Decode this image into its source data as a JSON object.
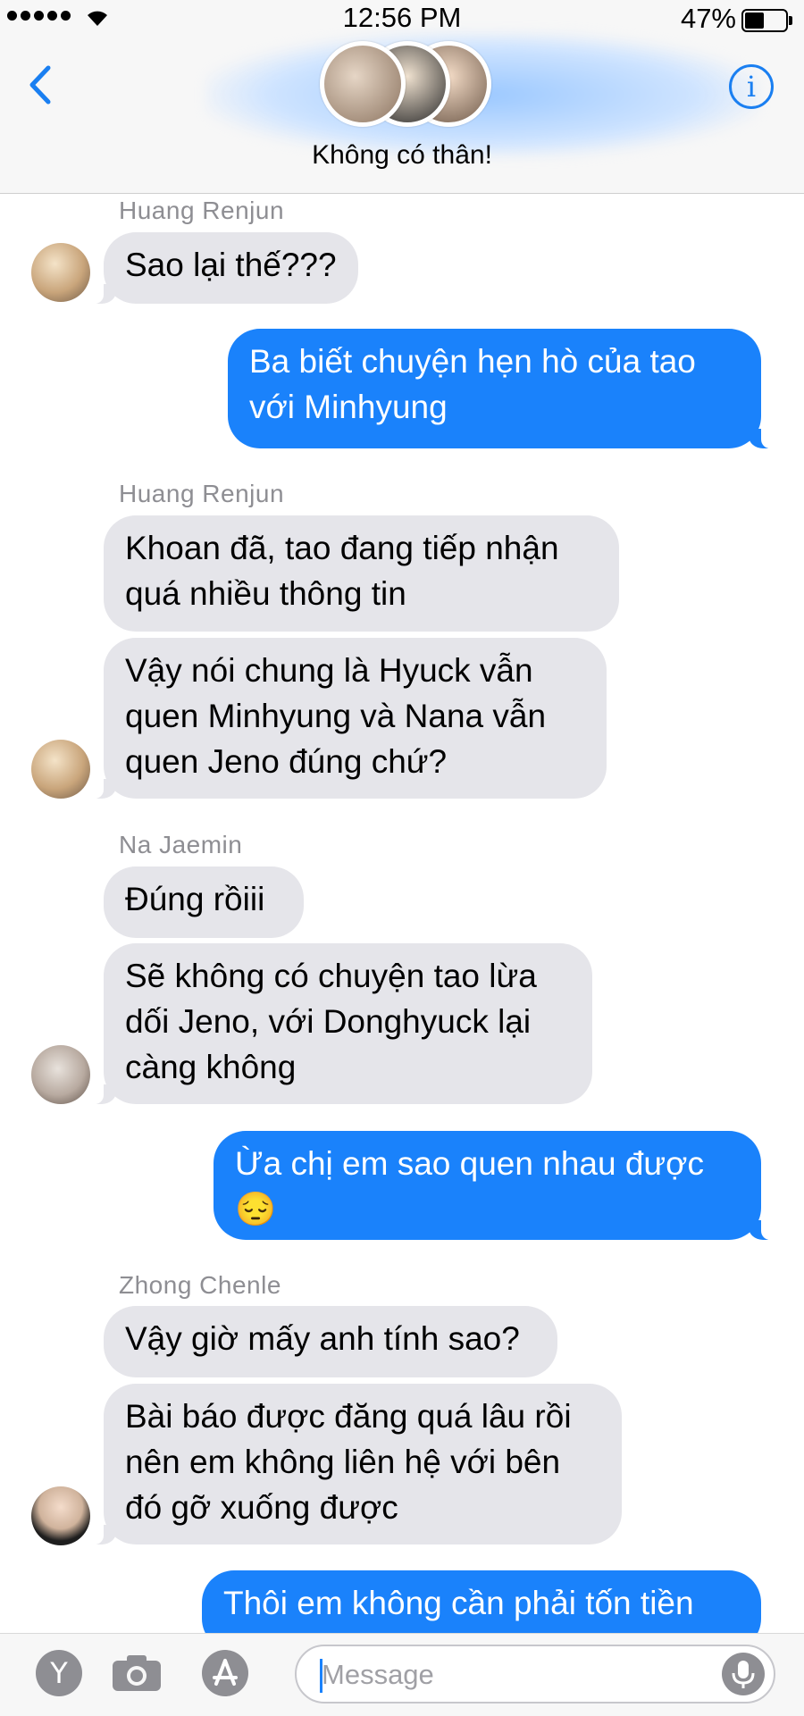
{
  "status_bar": {
    "time": "12:56 PM",
    "battery": "47%",
    "battery_level": 0.47
  },
  "header": {
    "group_name": "Không có thân!",
    "back_icon": "chevron-left-icon",
    "info_icon": "info-icon"
  },
  "messages": [
    {
      "sender": "Huang Renjun",
      "text": "Sao lại thế???",
      "direction": "in"
    },
    {
      "text": "Ba biết chuyện hẹn hò của tao với Minhyung",
      "direction": "out"
    },
    {
      "sender": "Huang Renjun",
      "text": "Khoan đã, tao đang tiếp nhận quá nhiều thông tin",
      "direction": "in"
    },
    {
      "text": "Vậy nói chung là Hyuck vẫn quen Minhyung và Nana vẫn quen Jeno đúng chứ?",
      "direction": "in"
    },
    {
      "sender": "Na Jaemin",
      "text": "Đúng rồiii",
      "direction": "in"
    },
    {
      "text": "Sẽ không có chuyện tao lừa dối Jeno, với Donghyuck lại càng không",
      "direction": "in"
    },
    {
      "text": "Ừa chị em sao quen nhau được 😔",
      "direction": "out"
    },
    {
      "sender": "Zhong Chenle",
      "text": "Vậy giờ mấy anh tính sao?",
      "direction": "in"
    },
    {
      "text": "Bài báo được đăng quá lâu rồi nên em không liên hệ với bên đó gỡ xuống được",
      "direction": "in"
    },
    {
      "text": "Thôi em không cần phải tốn tiền",
      "direction": "out"
    }
  ],
  "input": {
    "placeholder": "Message"
  },
  "bottom_icons": [
    "yahoo-icon",
    "camera-icon",
    "app-store-icon",
    "microphone-icon"
  ],
  "colors": {
    "accent": "#1a82fb",
    "incoming": "#e5e5ea",
    "header": "#f7f7f7"
  }
}
